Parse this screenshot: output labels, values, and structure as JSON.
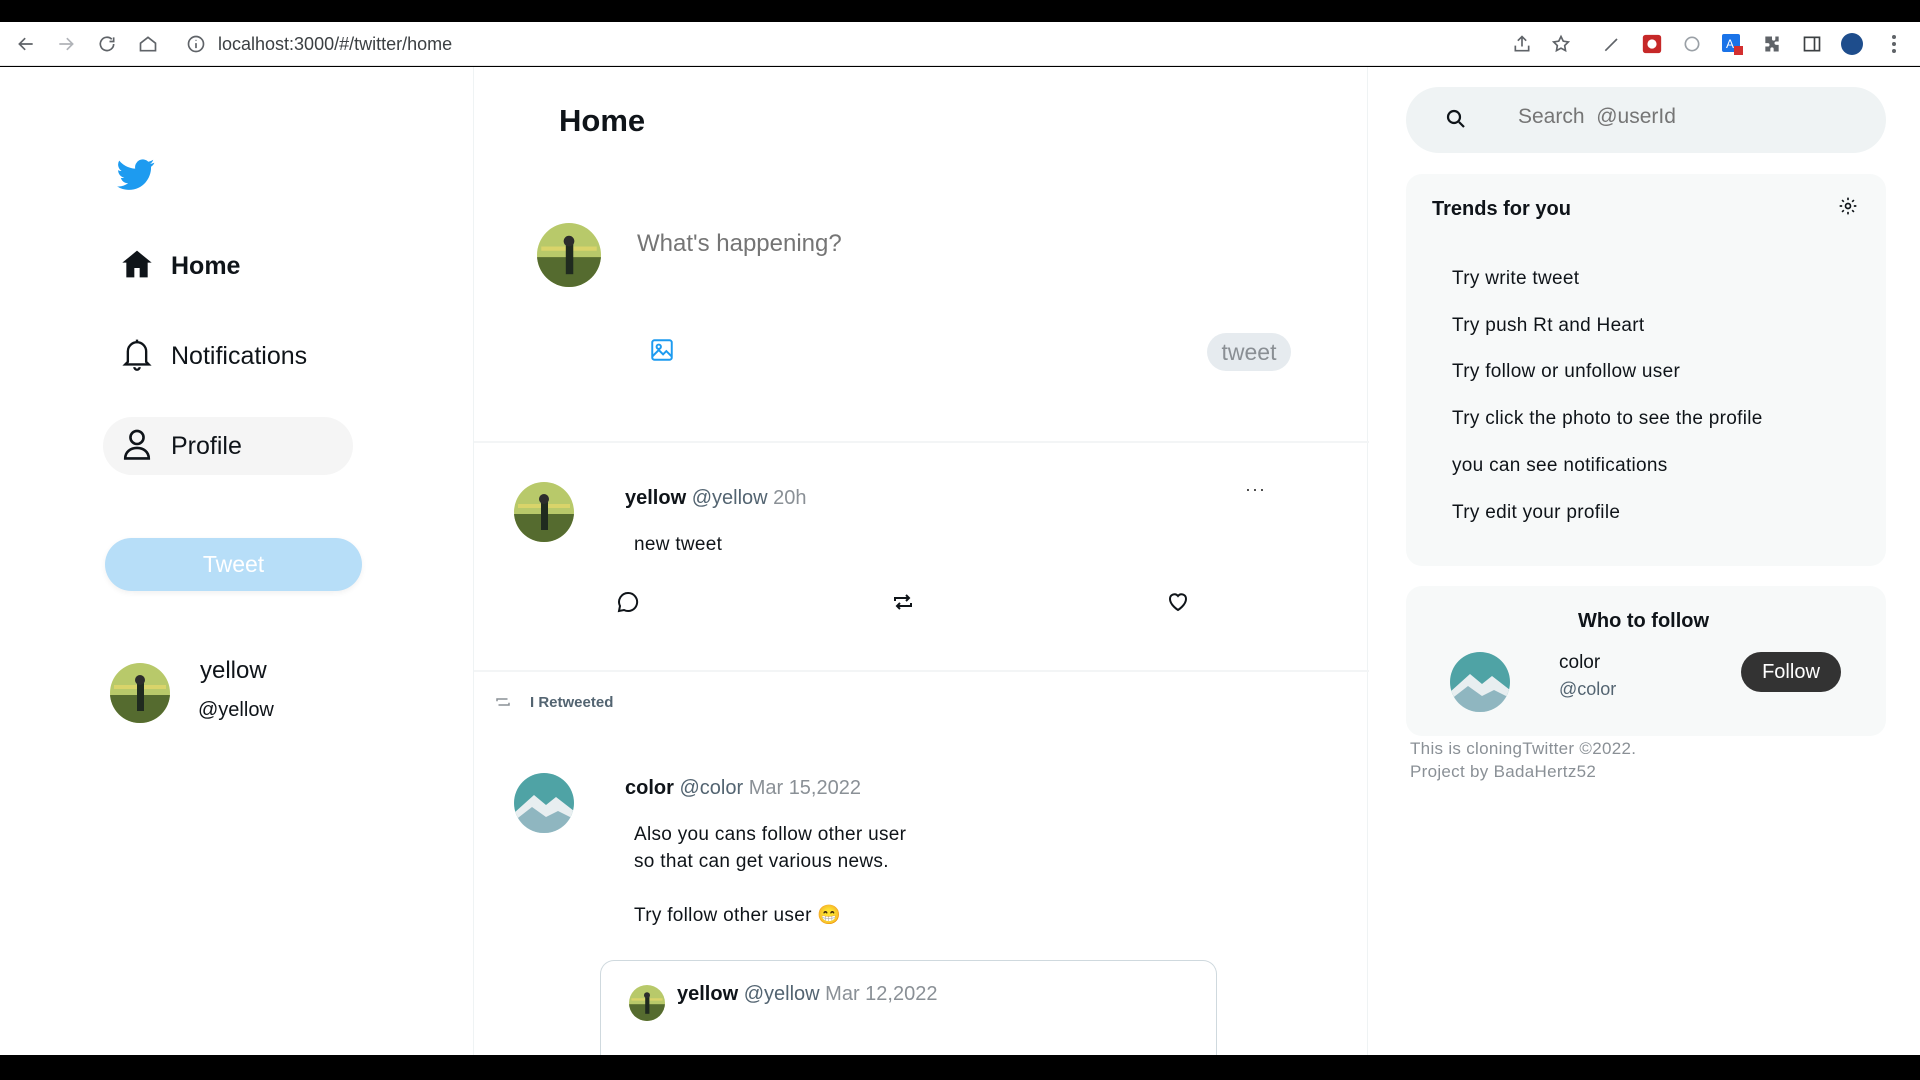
{
  "browser": {
    "url": "localhost:3000/#/twitter/home"
  },
  "sidebar": {
    "items": [
      {
        "label": "Home"
      },
      {
        "label": "Notifications"
      },
      {
        "label": "Profile"
      }
    ],
    "tweet_button": "Tweet",
    "user": {
      "name": "yellow",
      "handle": "@yellow"
    }
  },
  "main": {
    "title": "Home",
    "composer": {
      "placeholder": "What's happening?",
      "button": "tweet"
    },
    "tweets": [
      {
        "name": "yellow",
        "handle": "@yellow",
        "time": "20h",
        "text": "new tweet",
        "more": "···"
      }
    ],
    "retweet": {
      "label": "I Retweeted",
      "name": "color",
      "handle": "@color",
      "time": "Mar 15,2022",
      "lines": [
        "Also you cans follow other user",
        "so that can get various news.",
        "Try follow other user 😁"
      ],
      "quote": {
        "name": "yellow",
        "handle": "@yellow",
        "time": "Mar 12,2022"
      }
    }
  },
  "right": {
    "search_placeholder": "Search  @userId",
    "trends_title": "Trends for you",
    "trends": [
      "Try write tweet",
      "Try push Rt and Heart",
      "Try follow or unfollow user",
      "Try click the photo to see the profile",
      "you can see notifications",
      "Try edit your profile"
    ],
    "who_title": "Who to follow",
    "suggestion": {
      "name": "color",
      "handle": "@color",
      "button": "Follow"
    },
    "footer": [
      "This is cloningTwitter  ©2022.",
      "Project  by  BadaHertz52"
    ]
  },
  "colors": {
    "accent": "#1d9bf0",
    "tweet_button": "#b7def8",
    "follow_button": "#333333"
  }
}
